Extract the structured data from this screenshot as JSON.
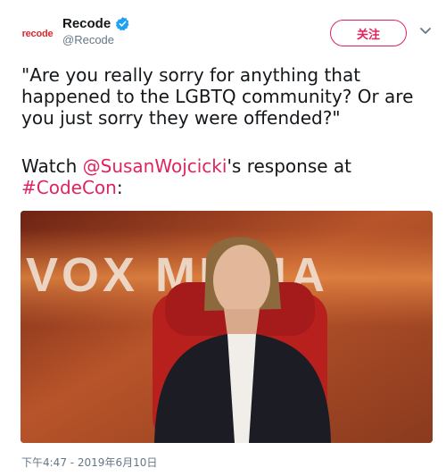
{
  "author": {
    "avatar_text": "recode",
    "display_name": "Recode",
    "handle": "@Recode"
  },
  "follow_label": "关注",
  "tweet": {
    "quote": "\"Are you really sorry for anything that happened to the LGBTQ community? Or are you just sorry they were offended?\"",
    "watch_prefix": "Watch ",
    "mention": "@SusanWojcicki",
    "watch_middle": "'s response at",
    "hashtag": "#CodeCon",
    "watch_suffix": ":"
  },
  "video": {
    "backdrop_text": "VOX MEDIA"
  },
  "timestamp": "下午4:47 - 2019年6月10日",
  "colors": {
    "accent": "#e0245e",
    "brand": "#e0262c",
    "verified": "#1da1f2"
  }
}
